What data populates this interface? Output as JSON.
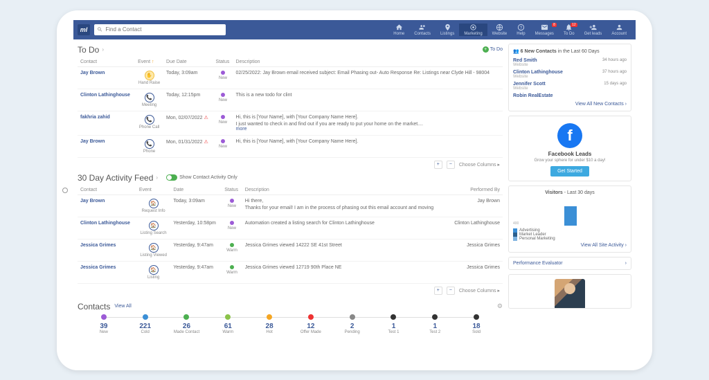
{
  "search": {
    "placeholder": "Find a Contact"
  },
  "nav": {
    "home": "Home",
    "contacts": "Contacts",
    "listings": "Listings",
    "marketing": "Marketing",
    "website": "Website",
    "help": "Help",
    "messages": "Messages",
    "todo": "To Do",
    "getleads": "Get leads",
    "account": "Account",
    "badge_messages": "8",
    "badge_todo": "12"
  },
  "todo": {
    "title": "To Do",
    "link": "To Do",
    "headers": {
      "contact": "Contact",
      "event": "Event",
      "due": "Due Date",
      "status": "Status",
      "desc": "Description"
    },
    "rows": [
      {
        "contact": "Jay Brown",
        "event": "Hand Raise",
        "due": "Today, 3:09am",
        "status": "New",
        "desc": "02/25/2022: Jay Brown email received subject: Email Phasing out- Auto Response Re: Listings near Clyde Hill - 98004"
      },
      {
        "contact": "Clinton Lathinghouse",
        "event": "Meeting",
        "due": "Today, 12:15pm",
        "status": "New",
        "desc": "This is a new todo for clint"
      },
      {
        "contact": "fakhria zahid",
        "event": "Phone Call",
        "due": "Mon, 02/07/2022",
        "alert": true,
        "status": "New",
        "desc": "Hi, this is [Your Name], with [Your Company Name Here].",
        "desc2": "I just wanted to check in and find out if you are ready to put your home on the market....",
        "more": "more"
      },
      {
        "contact": "Jay Brown",
        "event": "Phone",
        "due": "Mon, 01/31/2022",
        "alert": true,
        "status": "New",
        "desc": "Hi, this is [Your Name], with [Your Company Name Here]."
      }
    ],
    "choose": "Choose Columns"
  },
  "feed": {
    "title": "30 Day Activity Feed",
    "toggle": "Show Contact Activity Only",
    "headers": {
      "contact": "Contact",
      "event": "Event",
      "date": "Date",
      "status": "Status",
      "desc": "Description",
      "by": "Performed By"
    },
    "rows": [
      {
        "contact": "Jay Brown",
        "event": "Request Info",
        "date": "Today, 3:09am",
        "status": "New",
        "statusColor": "purple",
        "desc": "Hi there,",
        "desc2": "Thanks for your email! I am in the process of phasing out this email account and moving",
        "by": "Jay Brown"
      },
      {
        "contact": "Clinton Lathinghouse",
        "event": "Listing Search",
        "date": "Yesterday, 10:58pm",
        "status": "New",
        "statusColor": "purple",
        "desc": "Automation created a listing search for Clinton Lathinghouse",
        "by": "Clinton Lathinghouse"
      },
      {
        "contact": "Jessica Grimes",
        "event": "Listing Viewed",
        "date": "Yesterday, 9:47am",
        "status": "Warm",
        "statusColor": "green",
        "desc": "Jessica Grimes viewed 14222 SE 41st Street",
        "by": "Jessica Grimes"
      },
      {
        "contact": "Jessica Grimes",
        "event": "Listing",
        "date": "Yesterday, 9:47am",
        "status": "Warm",
        "statusColor": "green",
        "desc": "Jessica Grimes viewed 12719 90th Place NE",
        "by": "Jessica Grimes"
      }
    ],
    "choose": "Choose Columns"
  },
  "contacts_strip": {
    "title": "Contacts",
    "viewall": "View All",
    "items": [
      {
        "num": "39",
        "label": "New",
        "color": "#9c5bd6"
      },
      {
        "num": "221",
        "label": "Cold",
        "color": "#3b8fd6"
      },
      {
        "num": "26",
        "label": "Made Contact",
        "color": "#4CAF50"
      },
      {
        "num": "61",
        "label": "Warm",
        "color": "#8BC34A"
      },
      {
        "num": "28",
        "label": "Hot",
        "color": "#f5a623"
      },
      {
        "num": "12",
        "label": "Offer Made",
        "color": "#e33"
      },
      {
        "num": "2",
        "label": "Pending",
        "color": "#888"
      },
      {
        "num": "1",
        "label": "Test 1",
        "color": "#333"
      },
      {
        "num": "1",
        "label": "Test 2",
        "color": "#333"
      },
      {
        "num": "18",
        "label": "Sold",
        "color": "#333"
      }
    ]
  },
  "side": {
    "new_contacts": {
      "prefix": "6 New Contacts",
      "suffix": " in the Last 60 Days",
      "items": [
        {
          "name": "Red Smith",
          "source": "Website",
          "time": "34 hours ago"
        },
        {
          "name": "Clinton Lathinghouse",
          "source": "Website",
          "time": "37 hours ago"
        },
        {
          "name": "Jennifer Scott",
          "source": "Website",
          "time": "15 days ago"
        },
        {
          "name": "Robin RealEstate",
          "source": "",
          "time": ""
        }
      ],
      "viewall": "View All New Contacts"
    },
    "fb": {
      "title": "Facebook Leads",
      "sub": "Grow your sphere for under $10 a day!",
      "btn": "Get Started"
    },
    "visitors": {
      "title": "Visitors",
      "sub": " - Last 30 days",
      "legend": [
        {
          "label": "Advertising",
          "color": "#3b8fd6"
        },
        {
          "label": "Market Leader",
          "color": "#2c5f8d"
        },
        {
          "label": "Personal Marketing",
          "color": "#7fb3e0"
        }
      ],
      "viewall": "View All Site Activity"
    },
    "perf": "Performance Evaluator"
  },
  "chart_data": {
    "type": "bar",
    "title": "Visitors - Last 30 days",
    "categories": [
      "Advertising",
      "Market Leader",
      "Personal Marketing"
    ],
    "series": [
      {
        "name": "Visitors",
        "values": [
          0,
          400,
          0
        ]
      }
    ],
    "ylim": [
      0,
      600
    ],
    "ylabel": "",
    "xlabel": ""
  }
}
